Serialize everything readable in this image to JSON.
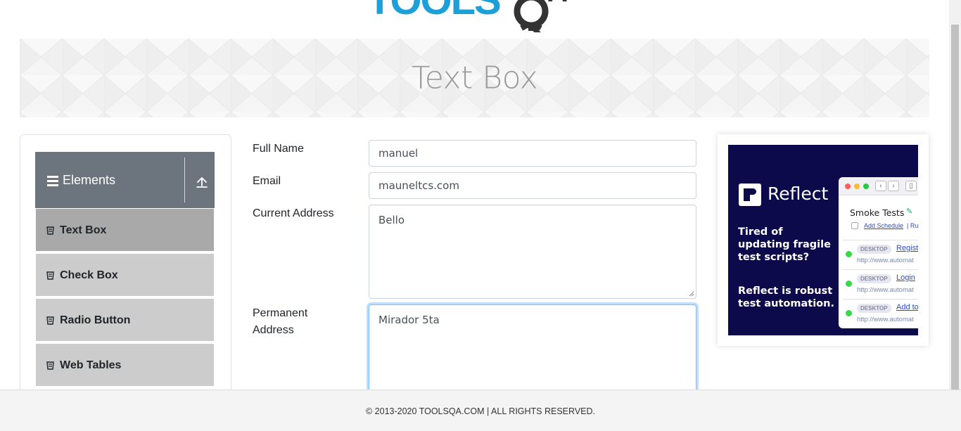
{
  "header": {
    "logo_text": "TOOLSQA"
  },
  "banner": {
    "title": "Text Box"
  },
  "sidebar": {
    "group": {
      "title": "Elements",
      "menu_icon": "hamburger-icon",
      "toggle_icon": "collapse-arrow-icon"
    },
    "items": [
      {
        "label": "Text Box",
        "icon": "item-icon",
        "active": true
      },
      {
        "label": "Check Box",
        "icon": "item-icon",
        "active": false
      },
      {
        "label": "Radio Button",
        "icon": "item-icon",
        "active": false
      },
      {
        "label": "Web Tables",
        "icon": "item-icon",
        "active": false
      }
    ]
  },
  "form": {
    "full_name": {
      "label": "Full Name",
      "value": "manuel"
    },
    "email": {
      "label": "Email",
      "value": "mauneltcs.com"
    },
    "current_address": {
      "label": "Current Address",
      "value": "Bello"
    },
    "permanent_address": {
      "label_line1": "Permanent",
      "label_line2": "Address",
      "value": "Mirador 5ta"
    }
  },
  "ad": {
    "brand": "Reflect",
    "text1": "Tired of updating fragile test scripts?",
    "text2": "Reflect is robust test automation.",
    "browser": {
      "title": "Smoke Tests",
      "schedule_link": "Add Schedule",
      "separator": "| Ru",
      "tests": [
        {
          "tag": "DESKTOP",
          "name": "Registr",
          "url": "http://www.automat"
        },
        {
          "tag": "DESKTOP",
          "name": "Login",
          "url": "http://www.automat"
        },
        {
          "tag": "DESKTOP",
          "name": "Add to",
          "url": "http://www.automat"
        }
      ]
    }
  },
  "footer": {
    "copyright": "© 2013-2020 TOOLSQA.COM | ALL RIGHTS RESERVED."
  },
  "colors": {
    "brand_blue": "#1d9fd8",
    "sidebar_header": "#6c757d",
    "menu_active": "#a9a9a9",
    "menu_item": "#cccccc",
    "ad_bg": "#0c0a4a",
    "focus_border": "#80bdff"
  }
}
